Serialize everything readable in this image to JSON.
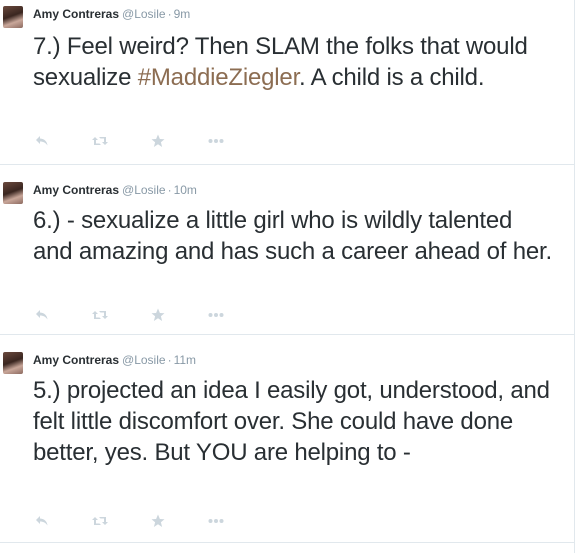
{
  "tweets": [
    {
      "author": "Amy Contreras",
      "handle": "@Losile",
      "separator": "·",
      "time": "9m",
      "text_before": "7.) Feel weird? Then SLAM the folks that would sexualize ",
      "hashtag": "#MaddieZiegler",
      "text_after": ". A child is a child."
    },
    {
      "author": "Amy Contreras",
      "handle": "@Losile",
      "separator": "·",
      "time": "10m",
      "text": "6.) - sexualize a little girl who is wildly talented and amazing and has such a career ahead of her."
    },
    {
      "author": "Amy Contreras",
      "handle": "@Losile",
      "separator": "·",
      "time": "11m",
      "text": "5.) projected an idea I easily got, understood, and felt little discomfort over. She could have done better, yes. But YOU are helping to -"
    }
  ],
  "actions": {
    "icons": [
      "reply-icon",
      "retweet-icon",
      "favorite-icon",
      "more-icon"
    ],
    "color": "#ccd6dd"
  },
  "colors": {
    "hashtag": "#8c6d52",
    "text": "#292f33",
    "meta": "#8899a6",
    "divider": "#e1e8ed"
  }
}
